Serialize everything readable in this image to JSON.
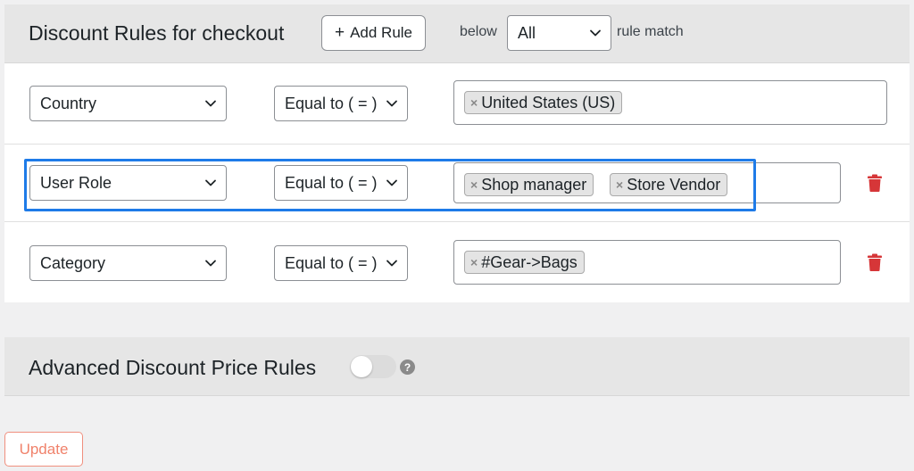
{
  "rules_panel": {
    "title": "Discount Rules for checkout",
    "add_rule_plus": "+",
    "add_rule_label": "Add Rule",
    "below_label": "below",
    "match_select_value": "All",
    "rule_match_label": "rule match"
  },
  "rules": [
    {
      "condition": "Country",
      "operator": "Equal to ( = )",
      "values": [
        "United States (US)"
      ],
      "deletable": false
    },
    {
      "condition": "User Role",
      "operator": "Equal to ( = )",
      "values": [
        "Shop manager",
        "Store Vendor"
      ],
      "deletable": true
    },
    {
      "condition": "Category",
      "operator": "Equal to ( = )",
      "values": [
        "#Gear->Bags"
      ],
      "deletable": true
    }
  ],
  "chip_remove_glyph": "×",
  "advanced_panel": {
    "title": "Advanced Discount Price Rules",
    "toggle_on": false,
    "help_glyph": "?"
  },
  "update_button": "Update",
  "colors": {
    "highlight": "#1e7be8",
    "trash": "#d63638",
    "update_accent": "#f0826b"
  },
  "icons": {
    "dropdown": "chevron-down-icon",
    "delete": "trash-icon",
    "help": "help-icon"
  }
}
